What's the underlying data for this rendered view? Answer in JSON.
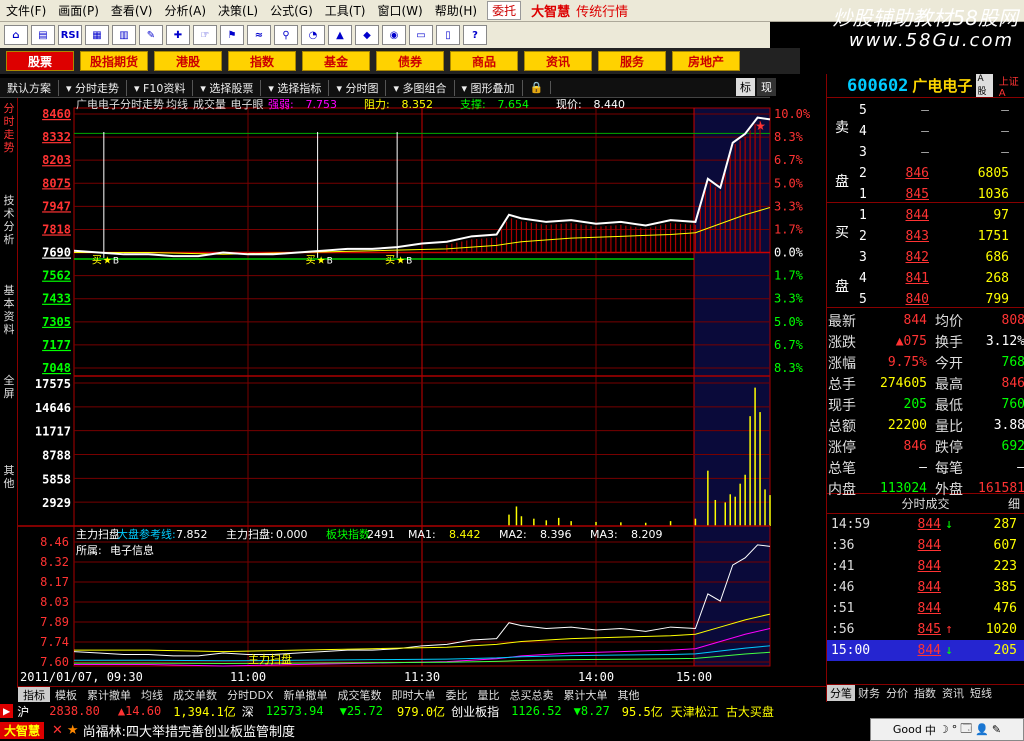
{
  "window": {
    "menus": [
      "文件(F)",
      "画面(P)",
      "查看(V)",
      "分析(A)",
      "决策(L)",
      "公式(G)",
      "工具(T)",
      "窗口(W)",
      "帮助(H)"
    ],
    "alert_button": "委托",
    "brand": "大智慧",
    "brand_sub": "传统行情",
    "watermark": "炒股辅助教材58股网",
    "watermark_url": "www.58Gu.com"
  },
  "toolbar": {
    "icons": [
      "home-icon",
      "chart-icon",
      "rsi-icon",
      "grid-icon",
      "calc-icon",
      "pencil-icon",
      "cross-icon",
      "drag-icon",
      "flag-icon",
      "wave-icon",
      "binoculars-icon",
      "pie-icon",
      "up-icon",
      "diamond-icon",
      "globe-icon",
      "card-icon",
      "book-icon",
      "help-icon"
    ],
    "rsi_label": "RSI",
    "help_label": "?"
  },
  "market_tabs": [
    {
      "label": "股票",
      "active": true
    },
    {
      "label": "股指期货",
      "active": false
    },
    {
      "label": "港股",
      "active": false
    },
    {
      "label": "指数",
      "active": false
    },
    {
      "label": "基金",
      "active": false
    },
    {
      "label": "债券",
      "active": false
    },
    {
      "label": "商品",
      "active": false
    },
    {
      "label": "资讯",
      "active": false
    },
    {
      "label": "服务",
      "active": false
    },
    {
      "label": "房地产",
      "active": false
    }
  ],
  "subbar": {
    "items": [
      "默认方案",
      "分时走势",
      "F10资料",
      "选择股票",
      "选择指标",
      "分时图",
      "多图组合",
      "图形叠加"
    ],
    "right_tabs": [
      {
        "label": "标",
        "on": true
      },
      {
        "label": "现",
        "on": false
      }
    ]
  },
  "left_tabs": [
    "分时走势",
    "技术分析",
    "基本资料",
    "全屏",
    "其他"
  ],
  "chart_header": {
    "title": "广电电子分时走势",
    "items": [
      "均线",
      "成交量",
      "电子眼"
    ],
    "strong_label": "强弱:",
    "strong_val": "7.753",
    "resist_label": "阻力:",
    "resist_val": "8.352",
    "support_label": "支撑:",
    "support_val": "7.654",
    "now_label": "现价:",
    "now_val": "8.440"
  },
  "chart_data": {
    "type": "line",
    "title": "广电电子分时走势",
    "prev_close": 7.69,
    "price_ticks": [
      "8460",
      "8332",
      "8203",
      "8075",
      "7947",
      "7818",
      "7690",
      "7562",
      "7433",
      "7305",
      "7177",
      "7048"
    ],
    "pct_ticks": [
      "10.0%",
      "8.3%",
      "6.7%",
      "5.0%",
      "3.3%",
      "1.7%",
      "0.0%",
      "1.7%",
      "3.3%",
      "5.0%",
      "6.7%",
      "8.3%"
    ],
    "ylim": [
      7.048,
      8.46
    ],
    "price": [
      [
        0,
        7.7
      ],
      [
        10,
        7.69
      ],
      [
        20,
        7.68
      ],
      [
        30,
        7.68
      ],
      [
        40,
        7.67
      ],
      [
        50,
        7.67
      ],
      [
        60,
        7.69
      ],
      [
        70,
        7.68
      ],
      [
        80,
        7.68
      ],
      [
        90,
        7.69
      ],
      [
        100,
        7.7
      ],
      [
        110,
        7.71
      ],
      [
        120,
        7.71
      ],
      [
        130,
        7.72
      ],
      [
        140,
        7.74
      ],
      [
        150,
        7.75
      ],
      [
        160,
        7.78
      ],
      [
        170,
        7.79
      ],
      [
        175,
        7.9
      ],
      [
        180,
        7.88
      ],
      [
        190,
        7.86
      ],
      [
        200,
        7.87
      ],
      [
        210,
        7.85
      ],
      [
        220,
        7.86
      ],
      [
        230,
        7.84
      ],
      [
        240,
        7.87
      ],
      [
        250,
        7.86
      ],
      [
        255,
        8.1
      ],
      [
        260,
        8.05
      ],
      [
        265,
        8.3
      ],
      [
        270,
        8.35
      ],
      [
        275,
        8.44
      ],
      [
        280,
        8.43
      ]
    ],
    "avg": [
      [
        0,
        7.69
      ],
      [
        30,
        7.69
      ],
      [
        60,
        7.68
      ],
      [
        90,
        7.69
      ],
      [
        120,
        7.7
      ],
      [
        150,
        7.71
      ],
      [
        170,
        7.73
      ],
      [
        180,
        7.75
      ],
      [
        200,
        7.77
      ],
      [
        220,
        7.78
      ],
      [
        240,
        7.79
      ],
      [
        250,
        7.8
      ],
      [
        260,
        7.85
      ],
      [
        270,
        7.9
      ],
      [
        280,
        7.94
      ]
    ],
    "volume_ticks": [
      "17575",
      "14646",
      "11717",
      "8788",
      "5858",
      "2929"
    ],
    "vol_max": 17575,
    "volume": [
      [
        175,
        1400
      ],
      [
        178,
        2400
      ],
      [
        180,
        1200
      ],
      [
        185,
        900
      ],
      [
        190,
        700
      ],
      [
        195,
        1000
      ],
      [
        200,
        600
      ],
      [
        210,
        500
      ],
      [
        220,
        450
      ],
      [
        230,
        400
      ],
      [
        240,
        600
      ],
      [
        250,
        900
      ],
      [
        255,
        6800
      ],
      [
        258,
        3200
      ],
      [
        262,
        2900
      ],
      [
        264,
        3900
      ],
      [
        266,
        3600
      ],
      [
        268,
        5200
      ],
      [
        270,
        6300
      ],
      [
        272,
        13500
      ],
      [
        274,
        17000
      ],
      [
        276,
        14000
      ],
      [
        278,
        4500
      ],
      [
        280,
        3800
      ]
    ],
    "x_times": [
      "2011/01/07, 09:30",
      "11:00",
      "11:30",
      "14:00",
      "15:00"
    ],
    "indicator": {
      "title": "主力扫盘",
      "ref_label": "大盘参考线:",
      "ref_val": "7.852",
      "scan_label": "主力扫盘:",
      "scan_val": "0.000",
      "sector_label": "板块指数",
      "sector_val": "2491",
      "ma1_label": "MA1:",
      "ma1_val": "8.442",
      "ma2_label": "MA2:",
      "ma2_val": "8.396",
      "ma3_label": "MA3:",
      "ma3_val": "8.209",
      "sector_name_label": "所属:",
      "sector_name": "电子信息",
      "ticks": [
        "8.46",
        "8.32",
        "8.17",
        "8.03",
        "7.89",
        "7.74",
        "7.60"
      ],
      "bottom_label": "主力扫盘"
    },
    "buy_labels": [
      "买",
      "买",
      "买"
    ],
    "buy_label_suffixes": [
      "B",
      "B",
      "B"
    ]
  },
  "bottom_tabs": [
    {
      "label": "指标",
      "on": true
    },
    {
      "label": "模板",
      "on": false
    },
    {
      "label": "累计撤单",
      "on": false
    },
    {
      "label": "均线",
      "on": false
    },
    {
      "label": "成交单数",
      "on": false
    },
    {
      "label": "分时DDX",
      "on": false
    },
    {
      "label": "新单撤单",
      "on": false
    },
    {
      "label": "成交笔数",
      "on": false
    },
    {
      "label": "即时大单",
      "on": false
    },
    {
      "label": "委比",
      "on": false
    },
    {
      "label": "量比",
      "on": false
    },
    {
      "label": "总买总卖",
      "on": false
    },
    {
      "label": "累计大单",
      "on": false
    },
    {
      "label": "其他",
      "on": false
    }
  ],
  "ticker": {
    "sh_label": "沪",
    "sh_val": "2838.80",
    "sh_chg": "14.60",
    "sh_amt": "1,394.1亿",
    "sz_label": "深",
    "sz_val": "12573.94",
    "sz_chg": "25.72",
    "sz_amt": "979.0亿",
    "cy_label": "创业板指",
    "cy_val": "1126.52",
    "cy_chg": "8.27",
    "cy_amt": "95.5亿",
    "tail": "天津松江 古大买盘"
  },
  "news": {
    "logo": "大智慧",
    "text": "尚福林:四大举措完善创业板监管制度"
  },
  "taskbar": {
    "items": [
      "Good",
      "中",
      "☽",
      "°",
      "🗔",
      "👤",
      "✎"
    ]
  },
  "stock": {
    "code": "600602",
    "name": "广电电子",
    "badge": "A股",
    "market_tag": "上证A",
    "sell_label": "卖盘",
    "buy_label": "买盘",
    "asks": [
      {
        "lvl": "5",
        "px": "–",
        "vol": "–"
      },
      {
        "lvl": "4",
        "px": "–",
        "vol": "–"
      },
      {
        "lvl": "3",
        "px": "–",
        "vol": "–"
      },
      {
        "lvl": "2",
        "px": "846",
        "vol": "6805"
      },
      {
        "lvl": "1",
        "px": "845",
        "vol": "1036"
      }
    ],
    "bids": [
      {
        "lvl": "1",
        "px": "844",
        "vol": "97"
      },
      {
        "lvl": "2",
        "px": "843",
        "vol": "1751"
      },
      {
        "lvl": "3",
        "px": "842",
        "vol": "686"
      },
      {
        "lvl": "4",
        "px": "841",
        "vol": "268"
      },
      {
        "lvl": "5",
        "px": "840",
        "vol": "799"
      }
    ],
    "stats": [
      {
        "k1": "最新",
        "v1": "844",
        "c1": "red",
        "k2": "均价",
        "v2": "808",
        "c2": "red"
      },
      {
        "k1": "涨跌",
        "v1": "▲075",
        "c1": "red",
        "k2": "换手",
        "v2": "3.12%",
        "c2": "white"
      },
      {
        "k1": "涨幅",
        "v1": "9.75%",
        "c1": "red",
        "k2": "今开",
        "v2": "768",
        "c2": "green"
      },
      {
        "k1": "总手",
        "v1": "274605",
        "c1": "yellow",
        "k2": "最高",
        "v2": "846",
        "c2": "red"
      },
      {
        "k1": "现手",
        "v1": "205",
        "c1": "green",
        "k2": "最低",
        "v2": "760",
        "c2": "green"
      },
      {
        "k1": "总额",
        "v1": "22200",
        "c1": "yellow",
        "k2": "量比",
        "v2": "3.88",
        "c2": "white"
      },
      {
        "k1": "涨停",
        "v1": "846",
        "c1": "red",
        "k2": "跌停",
        "v2": "692",
        "c2": "green"
      },
      {
        "k1": "总笔",
        "v1": "–",
        "c1": "white",
        "k2": "每笔",
        "v2": "–",
        "c2": "white"
      },
      {
        "k1": "内盘",
        "v1": "113024",
        "c1": "green",
        "k2": "外盘",
        "v2": "161581",
        "c2": "red"
      }
    ],
    "trades_title": "分时成交",
    "trades_close": "细",
    "trades": [
      {
        "t": "14:59",
        "p": "844",
        "a": "↓",
        "ac": "green",
        "v": "287"
      },
      {
        "t": ":36",
        "p": "844",
        "a": "",
        "ac": "",
        "v": "607"
      },
      {
        "t": ":41",
        "p": "844",
        "a": "",
        "ac": "",
        "v": "223"
      },
      {
        "t": ":46",
        "p": "844",
        "a": "",
        "ac": "",
        "v": "385"
      },
      {
        "t": ":51",
        "p": "844",
        "a": "",
        "ac": "",
        "v": "476"
      },
      {
        "t": ":56",
        "p": "845",
        "a": "↑",
        "ac": "red",
        "v": "1020"
      },
      {
        "t": "15:00",
        "p": "844",
        "a": "↓",
        "ac": "green",
        "v": "205"
      }
    ],
    "tabs": [
      {
        "label": "分笔",
        "on": true
      },
      {
        "label": "财务",
        "on": false
      },
      {
        "label": "分价",
        "on": false
      },
      {
        "label": "指数",
        "on": false
      },
      {
        "label": "资讯",
        "on": false
      },
      {
        "label": "短线",
        "on": false
      }
    ]
  }
}
